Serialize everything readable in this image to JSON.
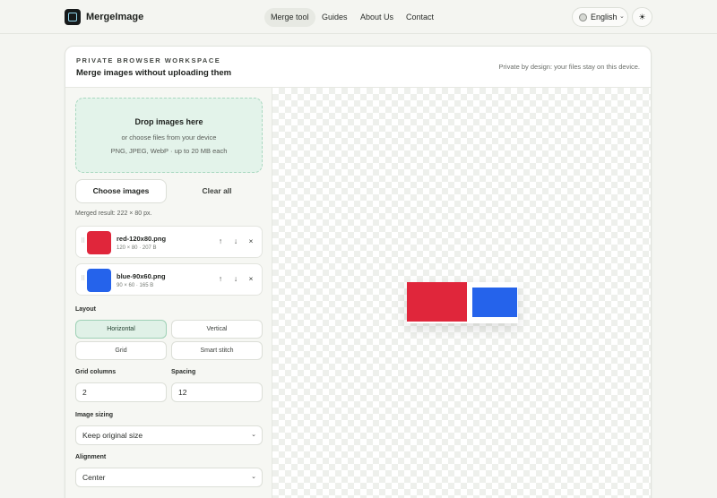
{
  "brand": {
    "name": "MergeImage"
  },
  "nav": {
    "items": [
      {
        "label": "Merge tool",
        "active": true
      },
      {
        "label": "Guides",
        "active": false
      },
      {
        "label": "About Us",
        "active": false
      },
      {
        "label": "Contact",
        "active": false
      }
    ],
    "language": "English",
    "language_chevron": "⌄",
    "theme_toggle": "☀"
  },
  "workspace": {
    "eyebrow": "PRIVATE BROWSER WORKSPACE",
    "headline": "Merge images without uploading them",
    "privacy_note": "Private by design: your files stay on this device."
  },
  "dropzone": {
    "title": "Drop images here",
    "subtitle": "or choose files from your device",
    "types": "PNG, JPEG, WebP · up to 20 MB each"
  },
  "buttons": {
    "choose": "Choose images",
    "clear": "Clear all"
  },
  "merged_result": "Merged result: 222 × 80 px.",
  "files": [
    {
      "name": "red-120x80.png",
      "meta": "120 × 80 · 207 B",
      "color": "#e0263b"
    },
    {
      "name": "blue-90x60.png",
      "meta": "90 × 60 · 165 B",
      "color": "#2563eb"
    }
  ],
  "file_actions": {
    "up": "↑",
    "down": "↓",
    "remove": "×",
    "grip": "⠿"
  },
  "layout": {
    "label": "Layout",
    "options": [
      "Horizontal",
      "Vertical",
      "Grid",
      "Smart stitch"
    ],
    "selected": "Horizontal"
  },
  "grid_columns": {
    "label": "Grid columns",
    "value": "2"
  },
  "spacing": {
    "label": "Spacing",
    "value": "12"
  },
  "image_sizing": {
    "label": "Image sizing",
    "value": "Keep original size"
  },
  "alignment": {
    "label": "Alignment",
    "value": "Center"
  },
  "select_chevron": "⌄",
  "colors": {
    "accent_bg": "#e0f1e7",
    "dropzone_bg": "#e3f3ea",
    "red_image": "#e0263b",
    "blue_image": "#2563eb"
  }
}
